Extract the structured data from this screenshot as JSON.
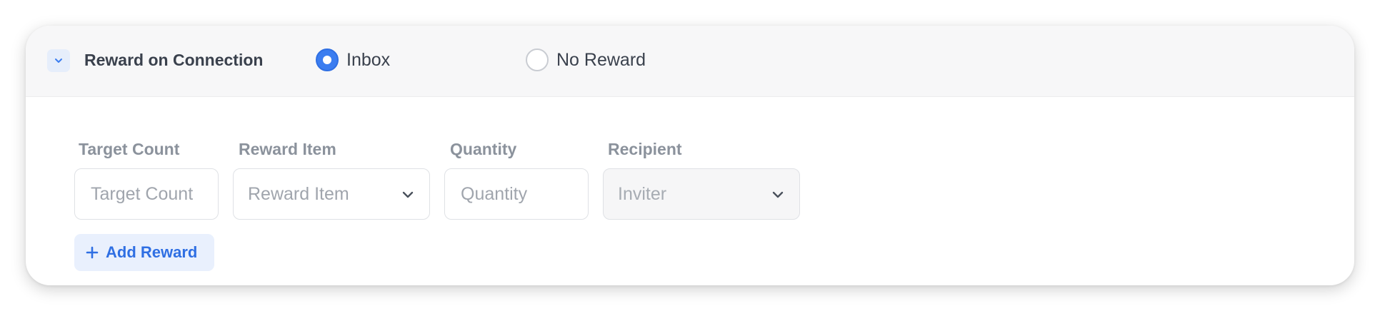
{
  "section": {
    "title": "Reward on Connection",
    "collapse_icon": "chevron-down-icon",
    "accent_color": "#3b7df0"
  },
  "reward_mode": {
    "options": [
      {
        "label": "Inbox",
        "selected": true
      },
      {
        "label": "No Reward",
        "selected": false
      }
    ]
  },
  "reward_row": {
    "target_count": {
      "label": "Target Count",
      "placeholder": "Target Count",
      "value": ""
    },
    "reward_item": {
      "label": "Reward Item",
      "placeholder": "Reward Item",
      "icon": "chevron-down-icon"
    },
    "quantity": {
      "label": "Quantity",
      "placeholder": "Quantity",
      "value": ""
    },
    "recipient": {
      "label": "Recipient",
      "value": "Inviter",
      "disabled": true,
      "icon": "chevron-down-icon"
    }
  },
  "add_reward": {
    "label": "Add Reward",
    "icon": "plus-icon"
  }
}
